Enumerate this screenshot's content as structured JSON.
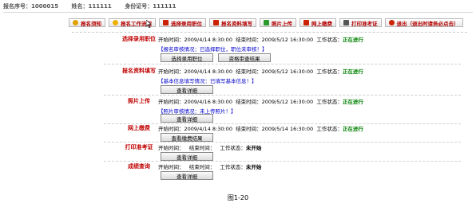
{
  "top": {
    "seq_label": "报名序号：1000015",
    "name_label": "姓名：111111",
    "id_label": "身份证号：111111"
  },
  "nav": [
    {
      "label": "报名须知",
      "color": "#e3a000",
      "icon": "info-icon"
    },
    {
      "label": "报名工作流程",
      "color": "#f0b000",
      "icon": "flow-icon"
    },
    {
      "label": "选择录用职位",
      "color": "#cc2200",
      "icon": "position-icon"
    },
    {
      "label": "报名资料填写",
      "color": "#cc2200",
      "icon": "form-icon"
    },
    {
      "label": "照片上传",
      "color": "#2a9a2a",
      "icon": "photo-icon"
    },
    {
      "label": "网上缴费",
      "color": "#cc2200",
      "icon": "payment-icon"
    },
    {
      "label": "打印准考证",
      "color": "#555555",
      "icon": "print-icon"
    },
    {
      "label": "退出（退出时请务必点击）",
      "color": "#cc2200",
      "icon": "exit-icon"
    }
  ],
  "rows": [
    {
      "title": "选择录用职位",
      "start": "开始时间：2009/4/14 8:30:00",
      "end": "结束时间：2009/5/12 16:30:00",
      "status_label": "工作状态：",
      "status": "正在进行",
      "note": "【报名审核情况：已选择职位，职位未审核！】",
      "buttons": [
        "选择录用职位",
        "资格审查结果"
      ]
    },
    {
      "title": "报名资料填写",
      "start": "开始时间：2009/4/14 8:30:00",
      "end": "结束时间：2009/5/12 16:30:00",
      "status_label": "工作状态：",
      "status": "正在进行",
      "note": "【基本信息填写情况：已填写基本信息！】",
      "buttons": [
        "查看详细"
      ]
    },
    {
      "title": "照片上传",
      "start": "开始时间：2009/4/16 8:30:00",
      "end": "结束时间：2009/5/12 16:30:00",
      "status_label": "工作状态：",
      "status": "正在进行",
      "note": "【照片审核情况：未上传照片！】",
      "buttons": [
        "查看详细"
      ]
    },
    {
      "title": "网上缴费",
      "start": "开始时间：2009/4/14 8:30:00",
      "end": "结束时间：2009/5/14 16:30:00",
      "status_label": "工作状态：",
      "status": "正在进行",
      "note": "",
      "buttons": [
        "查看缴费结果"
      ]
    },
    {
      "title": "打印准考证",
      "start": "开始时间：",
      "end": "结束时间：",
      "status_label": "工作状态：",
      "status": "未开始",
      "note": "",
      "buttons": [
        "查看详细"
      ]
    },
    {
      "title": "成绩查询",
      "start": "开始时间：",
      "end": "结束时间：",
      "status_label": "工作状态：",
      "status": "未开始",
      "note": "",
      "buttons": [
        "查看详细"
      ]
    }
  ],
  "caption": "图1-20"
}
